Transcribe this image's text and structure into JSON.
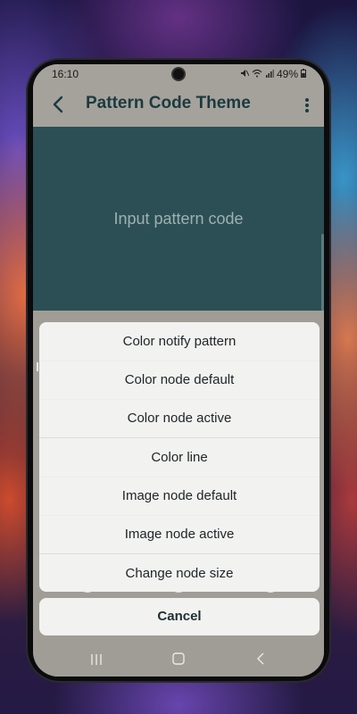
{
  "status_bar": {
    "time": "16:10",
    "battery": "49%",
    "icons": [
      "mute-icon",
      "wifi-icon",
      "signal-icon",
      "battery-icon"
    ]
  },
  "app_bar": {
    "title": "Pattern Code Theme",
    "back_icon": "chevron-left-icon",
    "menu_icon": "more-vertical-icon"
  },
  "pattern_input": {
    "placeholder": "Input pattern code"
  },
  "action_sheet": {
    "items": [
      {
        "label": "Color notify pattern"
      },
      {
        "label": "Color node default"
      },
      {
        "label": "Color node active"
      },
      {
        "label": "Color line"
      },
      {
        "label": "Image node default"
      },
      {
        "label": "Image node active"
      },
      {
        "label": "Change node size"
      }
    ],
    "cancel_label": "Cancel"
  },
  "nav_bar": {
    "icons": [
      "recent-apps-icon",
      "home-icon",
      "back-icon"
    ]
  },
  "colors": {
    "accent": "#2b4f55",
    "title": "#1c3a3e",
    "background": "#a09d97",
    "sheet": "#f2f2f0",
    "node": "#dfe3e6"
  }
}
